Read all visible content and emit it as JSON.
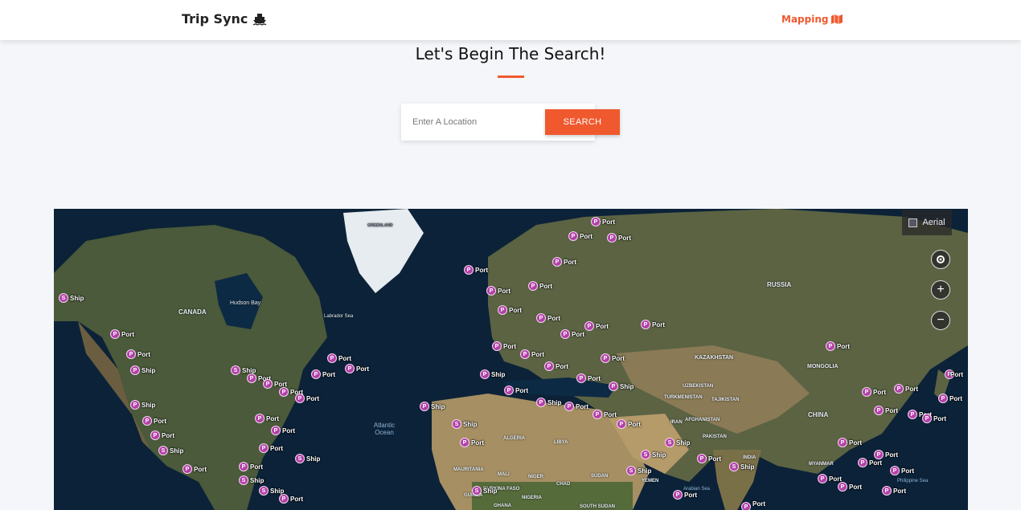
{
  "navbar": {
    "brand": "Trip Sync",
    "brand_icon": "ship-icon",
    "links": [
      {
        "label": "Mapping",
        "icon": "map-icon"
      }
    ]
  },
  "hero": {
    "heading": "Let's Begin The Search!"
  },
  "search": {
    "placeholder": "Enter A Location",
    "value": "",
    "button_label": "SEARCH"
  },
  "colors": {
    "accent": "#f0592e",
    "marker": "#b240a8"
  },
  "map": {
    "style_button": "Aerial",
    "controls": [
      "locate-icon",
      "zoom-in-icon",
      "zoom-out-icon"
    ],
    "region_labels": [
      "CANADA",
      "Hudson Bay",
      "Labrador Sea",
      "RUSSIA",
      "KAZAKHSTAN",
      "MONGOLIA",
      "UZBEKISTAN",
      "TURKMENISTAN",
      "TAJIKISTAN",
      "AFGHANISTAN",
      "IRAN",
      "PAKISTAN",
      "INDIA",
      "CHINA",
      "MYANMAR",
      "ALGERIA",
      "LIBYA",
      "MALI",
      "NIGER",
      "CHAD",
      "SUDAN",
      "YEMEN",
      "MAURITANIA",
      "BURKINA FASO",
      "NIGERIA",
      "GHANA",
      "GUINEA",
      "SOUTH SUDAN",
      "Philippine Sea",
      "Arabian Sea",
      "Atlantic Ocean",
      "GREENLAND"
    ],
    "marker_labels": {
      "port": "Port",
      "ship": "Ship",
      "port_letter": "P",
      "ship_letter": "S"
    }
  }
}
